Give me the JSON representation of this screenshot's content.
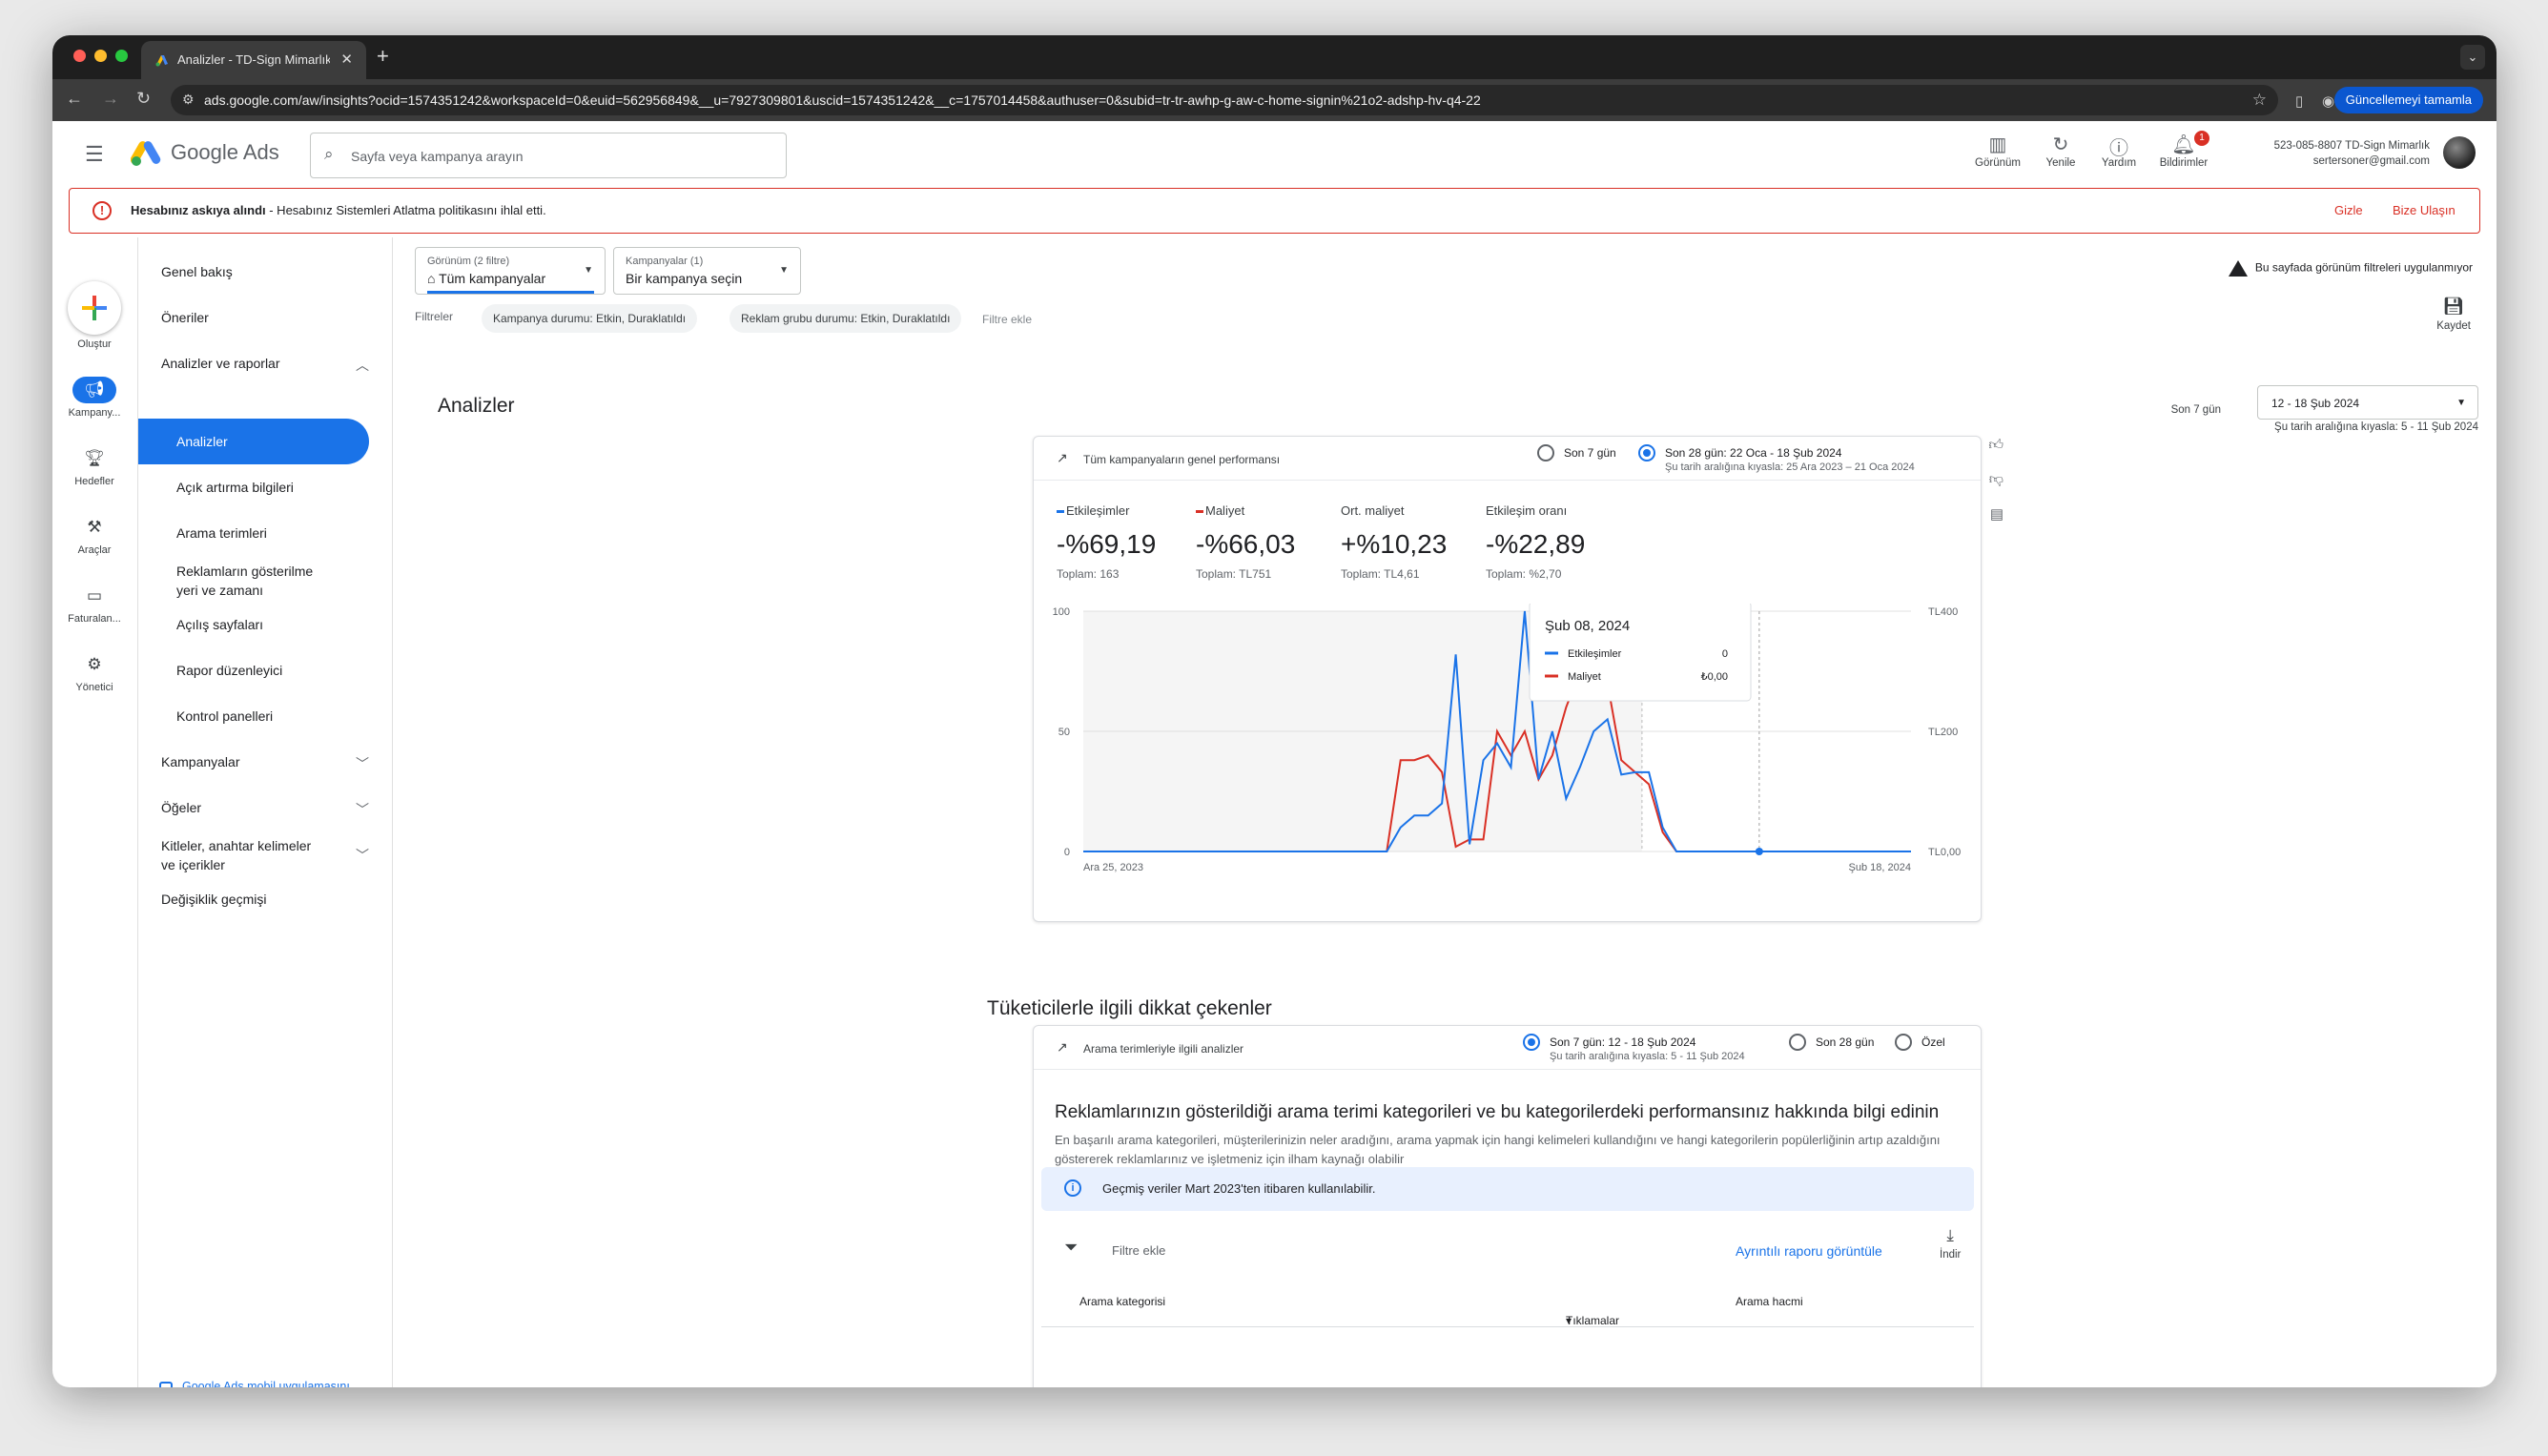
{
  "browser": {
    "tab_title": "Analizler - TD-Sign Mimarlık",
    "url": "ads.google.com/aw/insights?ocid=1574351242&workspaceId=0&euid=562956849&__u=7927309801&uscid=1574351242&__c=1757014458&authuser=0&subid=tr-tr-awhp-g-aw-c-home-signin%21o2-adshp-hv-q4-22",
    "update_button": "Güncellemeyi tamamla"
  },
  "header": {
    "product": "Google Ads",
    "search_placeholder": "Sayfa veya kampanya arayın",
    "tools": [
      "Görünüm",
      "Yenile",
      "Yardım",
      "Bildirimler"
    ],
    "notification_count": "1",
    "account_line1": "523-085-8807 TD-Sign Mimarlık",
    "account_line2": "sertersoner@gmail.com"
  },
  "alert": {
    "bold": "Hesabınız askıya alındı",
    "text": " - Hesabınız Sistemleri Atlatma politikasını ihlal etti.",
    "hide": "Gizle",
    "contact": "Bize Ulaşın"
  },
  "rail": {
    "create": "Oluştur",
    "campaigns": "Kampany...",
    "goals": "Hedefler",
    "tools": "Araçlar",
    "billing": "Faturalan...",
    "admin": "Yönetici"
  },
  "nav": {
    "overview": "Genel bakış",
    "recommendations": "Öneriler",
    "insights_reports": "Analizler ve raporlar",
    "insights": "Analizler",
    "auction": "Açık artırma bilgileri",
    "search_terms": "Arama terimleri",
    "when_where_1": "Reklamların gösterilme",
    "when_where_2": "yeri ve zamanı",
    "landing": "Açılış sayfaları",
    "report_editor": "Rapor düzenleyici",
    "dashboards": "Kontrol panelleri",
    "campaigns": "Kampanyalar",
    "assets": "Öğeler",
    "audiences_1": "Kitleler, anahtar kelimeler",
    "audiences_2": "ve içerikler",
    "change_history": "Değişiklik geçmişi",
    "mobile_1": "Google Ads mobil uygulamasını",
    "mobile_2": "indirin"
  },
  "toolbar": {
    "view_small": "Görünüm (2 filtre)",
    "view_value": "Tüm kampanyalar",
    "camp_small": "Kampanyalar (1)",
    "camp_value": "Bir kampanya seçin",
    "filters_label": "Filtreler",
    "chip1": "Kampanya durumu: Etkin, Duraklatıldı",
    "chip2": "Reklam grubu durumu: Etkin, Duraklatıldı",
    "filter_add": "Filtre ekle",
    "warning": "Bu sayfada görünüm filtreleri uygulanmıyor",
    "save": "Kaydet"
  },
  "page": {
    "title": "Analizler",
    "period_label": "Son 7 gün",
    "range": "12 - 18 Şub 2024",
    "compare": "Şu tarih aralığına kıyasla: 5 - 11 Şub 2024"
  },
  "perf_card": {
    "title": "Tüm kampanyaların genel performansı",
    "opt1": "Son 7 gün",
    "opt2": "Son 28 gün: 22 Oca - 18 Şub 2024",
    "opt2_sub": "Şu tarih aralığına kıyasla: 25 Ara 2023 – 21 Oca 2024",
    "metrics": [
      {
        "name": "Etkileşimler",
        "value": "-%69,19",
        "total": "Toplam: 163",
        "color": "#1a73e8"
      },
      {
        "name": "Maliyet",
        "value": "-%66,03",
        "total": "Toplam: TL751",
        "color": "#d93025"
      },
      {
        "name": "Ort. maliyet",
        "value": "+%10,23",
        "total": "Toplam: TL4,61",
        "color": ""
      },
      {
        "name": "Etkileşim oranı",
        "value": "-%22,89",
        "total": "Toplam: %2,70",
        "color": ""
      }
    ]
  },
  "chart_data": {
    "type": "line",
    "x_start": "Ara 25, 2023",
    "x_end": "Şub 18, 2024",
    "x_marker": "30/1",
    "left_axis": [
      "100",
      "50",
      "0"
    ],
    "right_axis": [
      "TL400",
      "TL200",
      "TL0,00"
    ],
    "ylim_left": [
      0,
      100
    ],
    "ylim_right": [
      0,
      400
    ],
    "series": [
      {
        "name": "Etkileşimler",
        "color": "#1a73e8",
        "values": [
          0,
          0,
          0,
          0,
          0,
          0,
          0,
          0,
          0,
          0,
          0,
          0,
          0,
          0,
          0,
          0,
          0,
          0,
          0,
          0,
          0,
          0,
          0,
          0,
          0,
          0,
          0,
          0,
          0,
          0,
          0,
          0,
          0,
          0,
          0,
          0,
          0,
          0,
          0,
          0,
          0,
          0,
          0,
          0,
          0,
          0,
          0,
          0,
          0,
          0,
          0,
          0,
          0,
          0,
          0,
          0,
          0,
          0,
          0,
          0,
          0,
          0,
          0,
          0,
          0,
          0,
          0,
          0,
          0,
          0,
          0,
          0,
          0,
          0,
          0,
          0,
          0,
          0,
          0,
          0,
          0,
          0,
          0,
          0,
          0,
          0,
          0,
          0,
          0,
          0,
          0,
          0,
          0,
          0,
          0,
          0,
          0,
          0,
          0,
          0,
          0,
          0,
          0,
          0,
          0,
          0,
          0,
          0,
          0,
          0,
          0,
          0,
          0,
          0,
          0,
          0,
          0,
          0,
          0,
          0,
          0,
          0,
          0,
          0,
          0,
          0,
          0,
          0,
          0,
          0,
          0,
          0,
          0,
          0,
          0,
          0,
          0,
          0,
          0,
          0
        ]
      },
      {
        "name": "Maliyet",
        "color": "#d93025",
        "values": []
      }
    ],
    "plot": {
      "blue": [
        [
          0,
          0
        ],
        [
          22,
          0
        ],
        [
          23,
          10
        ],
        [
          24,
          15
        ],
        [
          25,
          15
        ],
        [
          26,
          20
        ],
        [
          27,
          82
        ],
        [
          28,
          3
        ],
        [
          29,
          38
        ],
        [
          30,
          45
        ],
        [
          31,
          35
        ],
        [
          32,
          100
        ],
        [
          33,
          30
        ],
        [
          34,
          50
        ],
        [
          35,
          22
        ],
        [
          36,
          35
        ],
        [
          37,
          50
        ],
        [
          38,
          55
        ],
        [
          39,
          32
        ],
        [
          40,
          33
        ],
        [
          41,
          33
        ],
        [
          42,
          10
        ],
        [
          43,
          0
        ],
        [
          60,
          0
        ]
      ],
      "red": [
        [
          0,
          0
        ],
        [
          22,
          0
        ],
        [
          23,
          38
        ],
        [
          24,
          38
        ],
        [
          25,
          40
        ],
        [
          26,
          33
        ],
        [
          27,
          2
        ],
        [
          28,
          5
        ],
        [
          29,
          5
        ],
        [
          30,
          50
        ],
        [
          31,
          40
        ],
        [
          32,
          50
        ],
        [
          33,
          30
        ],
        [
          34,
          40
        ],
        [
          35,
          60
        ],
        [
          36,
          75
        ],
        [
          37,
          75
        ],
        [
          38,
          70
        ],
        [
          39,
          38
        ],
        [
          40,
          33
        ],
        [
          41,
          28
        ],
        [
          42,
          8
        ],
        [
          43,
          0
        ],
        [
          60,
          0
        ]
      ],
      "x_max": 60,
      "marker_x": 40.5,
      "hover_x": 49
    },
    "tooltip": {
      "date": "Şub 08, 2024",
      "rows": [
        {
          "name": "Etkileşimler",
          "value": "0",
          "color": "#1a73e8"
        },
        {
          "name": "Maliyet",
          "value": "₺0,00",
          "color": "#d93025"
        }
      ]
    }
  },
  "consumer": {
    "section_title": "Tüketicilerle ilgili dikkat çekenler",
    "card_title": "Arama terimleriyle ilgili analizler",
    "opt1": "Son 7 gün: 12 - 18 Şub 2024",
    "opt1_sub": "Şu tarih aralığına kıyasla: 5 - 11 Şub 2024",
    "opt2": "Son 28 gün",
    "opt3": "Özel",
    "heading": "Reklamlarınızın gösterildiği arama terimi kategorileri ve bu kategorilerdeki performansınız hakkında bilgi edinin",
    "desc": "En başarılı arama kategorileri, müşterilerinizin neler aradığını, arama yapmak için hangi kelimeleri kullandığını ve hangi kategorilerin popülerliğinin artıp azaldığını göstererek reklamlarınız ve işletmeniz için ilham kaynağı olabilir",
    "info": "Geçmiş veriler Mart 2023'ten itibaren kullanılabilir.",
    "filter_add": "Filtre ekle",
    "detail_link": "Ayrıntılı raporu görüntüle",
    "download": "İndir",
    "col1": "Arama kategorisi",
    "col2": "Tıklamalar",
    "col3": "Arama hacmi"
  }
}
